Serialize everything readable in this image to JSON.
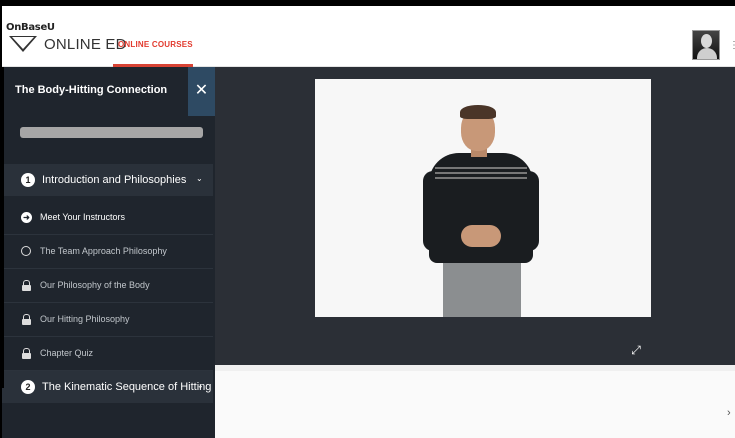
{
  "header": {
    "logo_text": "OnBaseU",
    "brand": "ONLINE ED",
    "nav_active": "ONLINE COURSES",
    "menu_glyph": "⋮",
    "accent_color": "#e23b2f"
  },
  "sidebar": {
    "course_title": "The Body-Hitting Connection",
    "close_glyph": "✕",
    "chapters": [
      {
        "number": "1",
        "title": "Introduction and Philosophies",
        "chevron": "⌄",
        "lessons": [
          {
            "title": "Meet Your Instructors",
            "icon": "arrow-circle-icon",
            "glyph": "➜"
          },
          {
            "title": "The Team Approach Philosophy",
            "icon": "circle-icon"
          },
          {
            "title": "Our Philosophy of the Body",
            "icon": "lock-icon"
          },
          {
            "title": "Our Hitting Philosophy",
            "icon": "lock-icon"
          },
          {
            "title": "Chapter Quiz",
            "icon": "lock-icon"
          }
        ]
      },
      {
        "number": "2",
        "title": "The Kinematic Sequence of Hitting",
        "chevron": "⌄"
      }
    ]
  },
  "player": {
    "expand_glyph": "⤢",
    "next_glyph": "›"
  },
  "colors": {
    "sidebar_bg": "#1f252d",
    "chapter_bg": "#2a313a",
    "close_bg": "#2e4a63",
    "player_bg": "#2b2f36"
  }
}
